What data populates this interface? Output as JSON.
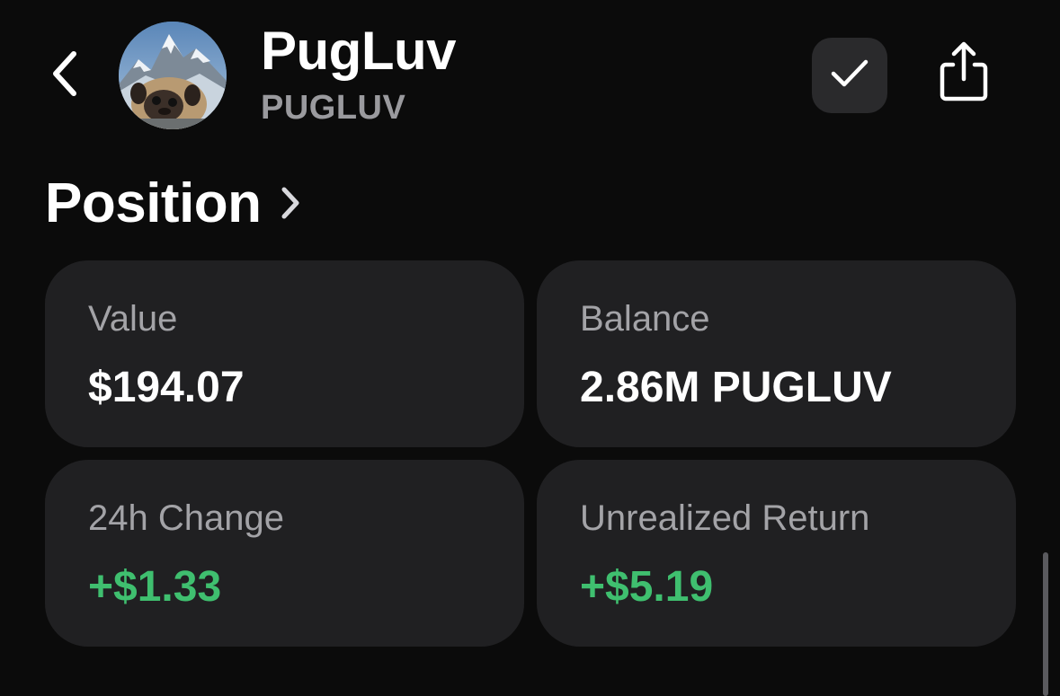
{
  "header": {
    "token_name": "PugLuv",
    "token_symbol": "PUGLUV",
    "avatar_icon": "pug-mountain-avatar",
    "back_icon": "chevron-left-icon",
    "check_icon": "checkmark-icon",
    "share_icon": "share-icon"
  },
  "position": {
    "title": "Position",
    "title_icon": "chevron-right-icon",
    "cards": {
      "value": {
        "label": "Value",
        "amount": "$194.07"
      },
      "balance": {
        "label": "Balance",
        "amount": "2.86M PUGLUV"
      },
      "change_24h": {
        "label": "24h Change",
        "amount": "+$1.33"
      },
      "unrealized_return": {
        "label": "Unrealized Return",
        "amount": "+$5.19"
      }
    }
  },
  "colors": {
    "background": "#0b0b0b",
    "card": "#202022",
    "positive": "#3fbf6f",
    "muted": "#a3a3a7"
  }
}
